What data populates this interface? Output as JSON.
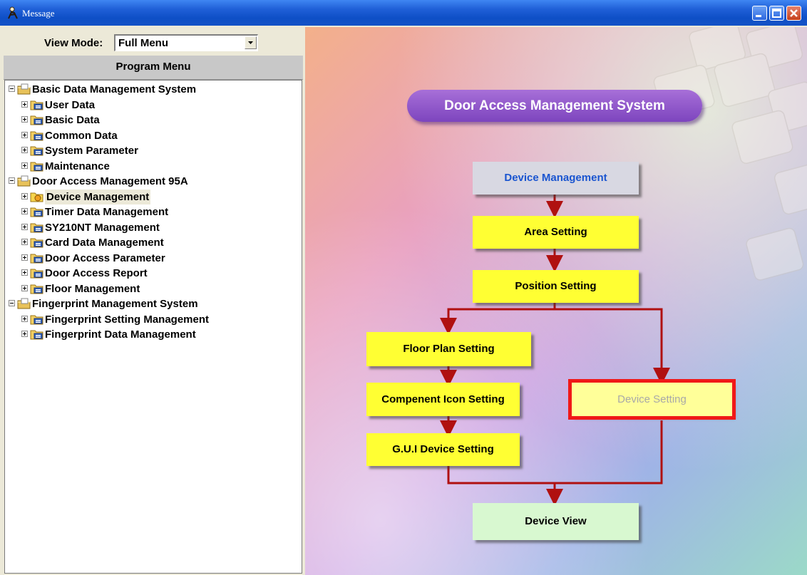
{
  "window": {
    "title": "Message"
  },
  "left_panel": {
    "view_mode_label": "View Mode:",
    "view_mode_value": "Full Menu",
    "program_menu_title": "Program Menu",
    "tree": [
      {
        "label": "Basic Data Management System",
        "level": 0,
        "expanded": true
      },
      {
        "label": "User Data",
        "level": 1
      },
      {
        "label": "Basic Data",
        "level": 1
      },
      {
        "label": "Common Data",
        "level": 1
      },
      {
        "label": "System Parameter",
        "level": 1
      },
      {
        "label": "Maintenance",
        "level": 1
      },
      {
        "label": "Door Access Management 95A",
        "level": 0,
        "expanded": true
      },
      {
        "label": "Device Management",
        "level": 1,
        "selected": true
      },
      {
        "label": "Timer Data Management",
        "level": 1
      },
      {
        "label": "SY210NT Management",
        "level": 1
      },
      {
        "label": "Card Data Management",
        "level": 1
      },
      {
        "label": "Door Access Parameter",
        "level": 1
      },
      {
        "label": "Door Access Report",
        "level": 1
      },
      {
        "label": "Floor Management",
        "level": 1
      },
      {
        "label": "Fingerprint Management System",
        "level": 0,
        "expanded": true
      },
      {
        "label": "Fingerprint Setting Management",
        "level": 1
      },
      {
        "label": "Fingerprint Data Management",
        "level": 1
      }
    ]
  },
  "flow": {
    "title": "Door Access Management System",
    "device_management": "Device Management",
    "area_setting": "Area Setting",
    "position_setting": "Position Setting",
    "floor_plan_setting": "Floor Plan Setting",
    "component_icon_setting": "Compenent Icon Setting",
    "gui_device_setting": "G.U.I Device Setting",
    "device_setting": "Device Setting",
    "device_view": "Device View"
  },
  "colors": {
    "title_bar": "#1452C6",
    "title_pill": "#8B55C8",
    "flow_yellow": "#FFFF33",
    "flow_highlight_border": "#F01818",
    "arrow_color": "#B01010"
  }
}
